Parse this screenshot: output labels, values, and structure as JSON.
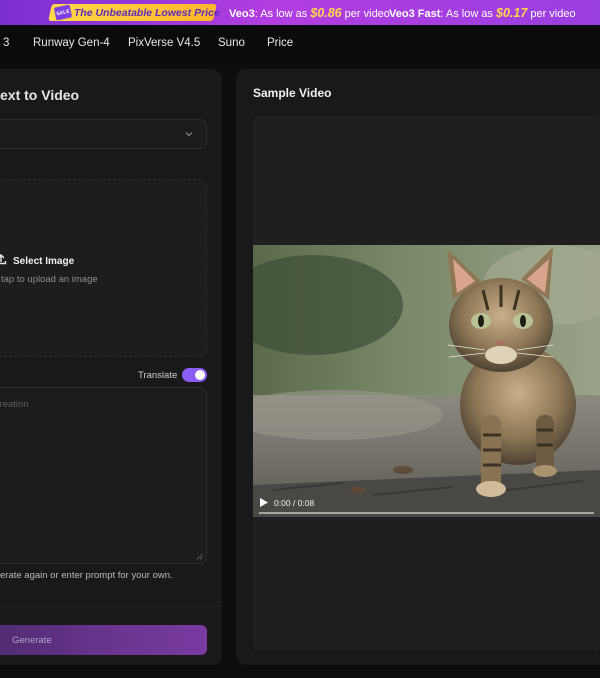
{
  "promo": {
    "badge": "SALE",
    "headline": "The Unbeatable Lowest Price",
    "offers": [
      {
        "model": "Veo3",
        "prefix": ": As low as ",
        "price": "$0.86",
        "suffix": " per video"
      },
      {
        "model": "Veo3 Fast",
        "prefix": ": As low as ",
        "price": "$0.17",
        "suffix": " per video"
      }
    ]
  },
  "nav": {
    "items": [
      "3",
      "Runway Gen-4",
      "PixVerse V4.5",
      "Suno",
      "Price"
    ]
  },
  "left": {
    "title": "ext to Video",
    "select_value": "",
    "upload_label": "Select Image",
    "upload_hint": "tap to upload an image",
    "translate_label": "Translate",
    "translate_on": true,
    "prompt_placeholder": "r creation",
    "prompt_value": "",
    "hint": "erate again or enter prompt for your own.",
    "generate_label": "Generate"
  },
  "right": {
    "title": "Sample Video",
    "video_time": "0:00 / 0:08",
    "video_progress": 0
  },
  "colors": {
    "accent": "#8b5cf6",
    "price": "#ffd84a",
    "panel": "#19191b",
    "background": "#0d0d0f"
  },
  "icons": [
    "sale-tag-icon",
    "chevron-down-icon",
    "upload-icon",
    "resize-handle-icon",
    "play-icon"
  ]
}
